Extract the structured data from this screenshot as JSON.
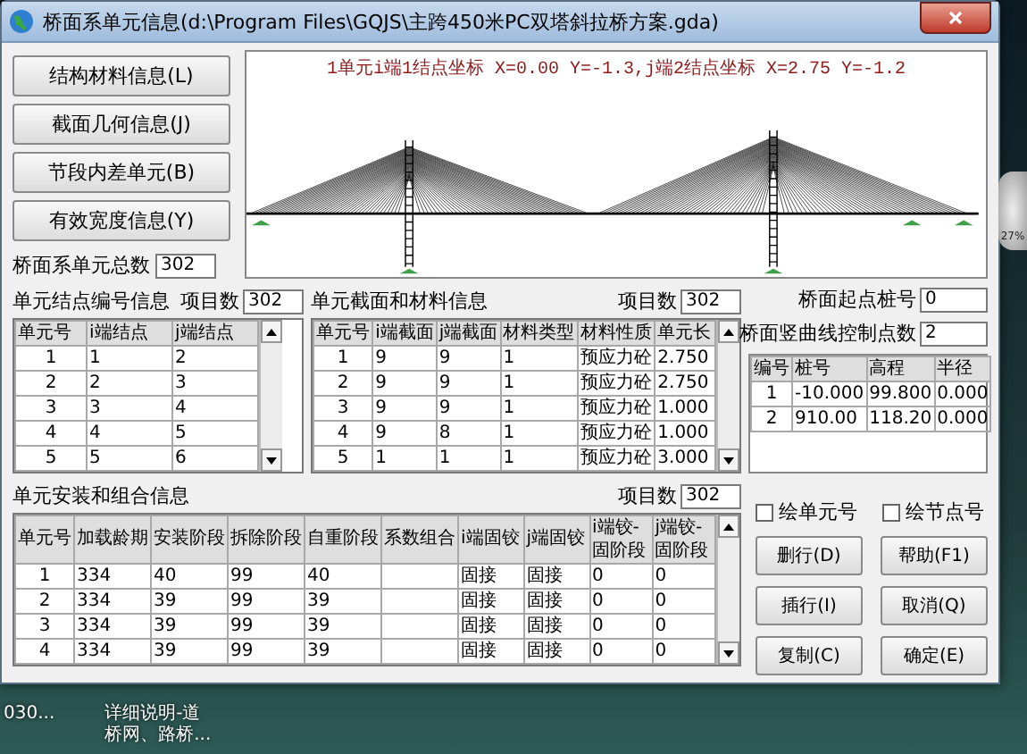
{
  "window": {
    "title": "桥面系单元信息(d:\\Program Files\\GQJS\\主跨450米PC双塔斜拉桥方案.gda)"
  },
  "side_buttons": [
    "结构材料信息(L)",
    "截面几何信息(J)",
    "节段内差单元(B)",
    "有效宽度信息(Y)"
  ],
  "preview": {
    "caption": "1单元i端1结点坐标 X=0.00 Y=-1.3,j端2结点坐标 X=2.75 Y=-1.2"
  },
  "total_elements": {
    "label": "桥面系单元总数",
    "value": "302"
  },
  "node_table": {
    "title": "单元结点编号信息",
    "count_label": "项目数",
    "count": "302",
    "columns": [
      "单元号",
      "i端结点",
      "j端结点"
    ],
    "rows": [
      [
        "1",
        "1",
        "2"
      ],
      [
        "2",
        "2",
        "3"
      ],
      [
        "3",
        "3",
        "4"
      ],
      [
        "4",
        "4",
        "5"
      ],
      [
        "5",
        "5",
        "6"
      ]
    ]
  },
  "section_table": {
    "title": "单元截面和材料信息",
    "count_label": "项目数",
    "count": "302",
    "columns": [
      "单元号",
      "i端截面",
      "j端截面",
      "材料类型",
      "材料性质",
      "单元长"
    ],
    "rows": [
      [
        "1",
        "9",
        "9",
        "1",
        "预应力砼",
        "2.750"
      ],
      [
        "2",
        "9",
        "9",
        "1",
        "预应力砼",
        "2.750"
      ],
      [
        "3",
        "9",
        "9",
        "1",
        "预应力砼",
        "1.000"
      ],
      [
        "4",
        "9",
        "8",
        "1",
        "预应力砼",
        "1.000"
      ],
      [
        "5",
        "1",
        "1",
        "1",
        "预应力砼",
        "3.000"
      ]
    ]
  },
  "deck": {
    "start_label": "桥面起点桩号",
    "start_value": "0",
    "points_label": "桥面竖曲线控制点数",
    "points_value": "2",
    "columns": [
      "编号",
      "桩号",
      "高程",
      "半径"
    ],
    "rows": [
      [
        "1",
        "-10.000",
        "99.800",
        "0.000"
      ],
      [
        "2",
        "910.00",
        "118.20",
        "0.000"
      ]
    ]
  },
  "assembly_table": {
    "title": "单元安装和组合信息",
    "count_label": "项目数",
    "count": "302",
    "columns": [
      "单元号",
      "加载龄期",
      "安装阶段",
      "拆除阶段",
      "自重阶段",
      "系数组合",
      "i端固铰",
      "j端固铰",
      "i端铰-固阶段",
      "j端铰-固阶段"
    ],
    "rows": [
      [
        "1",
        "334",
        "40",
        "99",
        "40",
        "",
        "固接",
        "固接",
        "0",
        "0"
      ],
      [
        "2",
        "334",
        "39",
        "99",
        "39",
        "",
        "固接",
        "固接",
        "0",
        "0"
      ],
      [
        "3",
        "334",
        "39",
        "99",
        "39",
        "",
        "固接",
        "固接",
        "0",
        "0"
      ],
      [
        "4",
        "334",
        "39",
        "99",
        "39",
        "",
        "固接",
        "固接",
        "0",
        "0"
      ]
    ]
  },
  "options": [
    {
      "label": "绘单元号",
      "checked": false
    },
    {
      "label": "绘节点号",
      "checked": false
    }
  ],
  "buttons": [
    "删行(D)",
    "帮助(F1)",
    "插行(I)",
    "取消(Q)",
    "复制(C)",
    "确定(E)"
  ],
  "desktop": {
    "icons": [
      {
        "lines": [
          "030..."
        ]
      },
      {
        "lines": [
          "详细说明-道",
          "桥网、路桥..."
        ]
      }
    ],
    "gadget_reading": "27%"
  }
}
